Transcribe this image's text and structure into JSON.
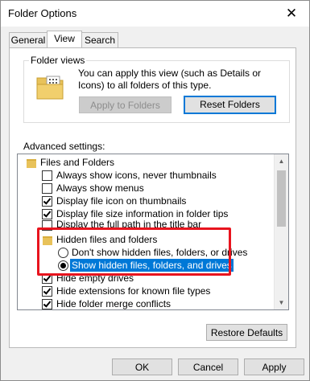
{
  "window": {
    "title": "Folder Options",
    "close_glyph": "✕"
  },
  "tabs": [
    {
      "label": "General",
      "active": false
    },
    {
      "label": "View",
      "active": true
    },
    {
      "label": "Search",
      "active": false
    }
  ],
  "folder_views": {
    "legend": "Folder views",
    "description": "You can apply this view (such as Details or Icons) to all folders of this type.",
    "apply_button": "Apply to Folders",
    "reset_button": "Reset Folders"
  },
  "advanced": {
    "label": "Advanced settings:",
    "items": [
      {
        "type": "folder",
        "label": "Files and Folders"
      },
      {
        "type": "checkbox",
        "label": "Always show icons, never thumbnails",
        "checked": false
      },
      {
        "type": "checkbox",
        "label": "Always show menus",
        "checked": false
      },
      {
        "type": "checkbox",
        "label": "Display file icon on thumbnails",
        "checked": true
      },
      {
        "type": "checkbox",
        "label": "Display file size information in folder tips",
        "checked": true
      },
      {
        "type": "checkbox",
        "label": "Display the full path in the title bar",
        "checked": false
      },
      {
        "type": "folder",
        "label": "Hidden files and folders"
      },
      {
        "type": "radio",
        "label": "Don't show hidden files, folders, or drives",
        "checked": false
      },
      {
        "type": "radio",
        "label": "Show hidden files, folders, and drives",
        "checked": true,
        "selected": true
      },
      {
        "type": "checkbox",
        "label": "Hide empty drives",
        "checked": true
      },
      {
        "type": "checkbox",
        "label": "Hide extensions for known file types",
        "checked": true
      },
      {
        "type": "checkbox",
        "label": "Hide folder merge conflicts",
        "checked": true
      }
    ],
    "restore_button": "Restore Defaults"
  },
  "footer": {
    "ok": "OK",
    "cancel": "Cancel",
    "apply": "Apply"
  },
  "colors": {
    "selection": "#0078d7",
    "highlight_border": "#e8141e",
    "folder": "#e8c25a"
  }
}
